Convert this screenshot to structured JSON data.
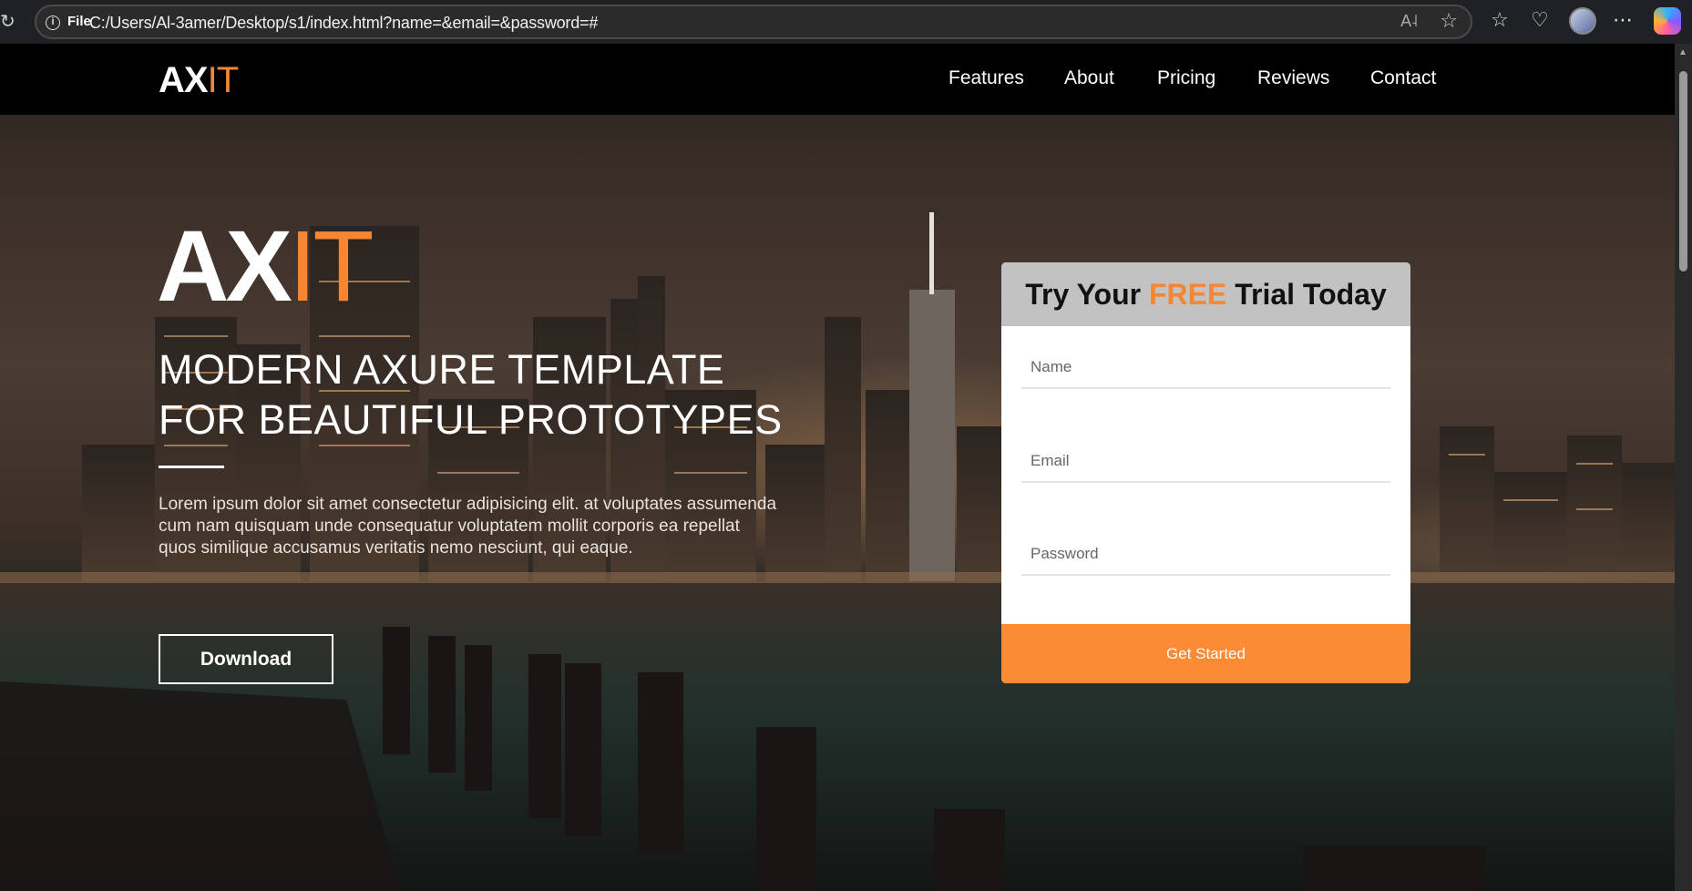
{
  "browser": {
    "file_label": "File",
    "url": "C:/Users/Al-3amer/Desktop/s1/index.html?name=&email=&password=#",
    "read_aloud_icon": "read-aloud-icon",
    "favorite_icon": "star-icon"
  },
  "nav": {
    "logo_ax": "AX",
    "logo_it": "IT",
    "items": [
      "Features",
      "About",
      "Pricing",
      "Reviews",
      "Contact"
    ]
  },
  "hero": {
    "title_ax": "AX",
    "title_it": "IT",
    "subtitle_line1": "MODERN AXURE TEMPLATE",
    "subtitle_line2": "FOR BEAUTIFUL PROTOTYPES",
    "description": "Lorem ipsum dolor sit amet consectetur adipisicing elit. at voluptates assumenda cum nam quisquam unde consequatur voluptatem mollit corporis ea repellat quos similique accusamus veritatis nemo nesciunt, qui eaque.",
    "download_label": "Download"
  },
  "form": {
    "title_before": "Try Your ",
    "title_free": "FREE",
    "title_after": " Trial Today",
    "name_placeholder": "Name",
    "email_placeholder": "Email",
    "password_placeholder": "Password",
    "submit_label": "Get Started"
  },
  "colors": {
    "accent": "#f58634",
    "button": "#fb8b34",
    "nav_bg": "#000000",
    "card_header_bg": "#c2c2c2"
  }
}
